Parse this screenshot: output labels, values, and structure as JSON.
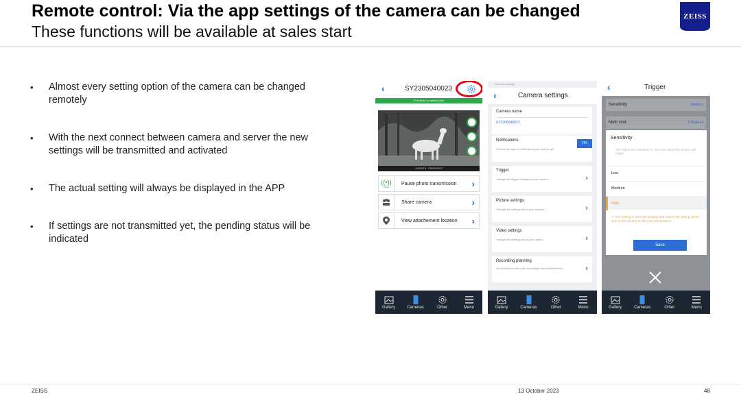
{
  "header": {
    "title": "Remote control: Via the app settings of the camera can be changed",
    "subtitle": "These functions will be available at sales start",
    "logo": "ZEISS"
  },
  "bullets": [
    "Almost every setting option of the camera can be changed remotely",
    "With the next connect between camera and server the new settings will be transmitted and activated",
    "The actual setting will always be displayed in the APP",
    "If settings are not transmitted yet, the pending status will be indicated"
  ],
  "phone1": {
    "camera_id": "SY2305040023",
    "sync_banner": "Pull down to synchronize",
    "photo_caption": "04/04/15 - 05/26/2023",
    "status_small": "Online",
    "rows": [
      "Pause photo transmission",
      "Share camera",
      "View attachement location"
    ]
  },
  "phone2": {
    "status_small": "Camera settings",
    "title": "Camera settings",
    "camera_name_label": "Camera name",
    "camera_name_value": "SY2305040023",
    "notifications": {
      "title": "Notifications",
      "desc": "Choose the type of notifications you want to get",
      "toggle": "ON"
    },
    "cards": [
      {
        "title": "Trigger",
        "desc": "Change the trigger settings of your camera"
      },
      {
        "title": "Picture settings",
        "desc": "Change the settings about your pictures"
      },
      {
        "title": "Video settings",
        "desc": "Change the settings about your videos"
      },
      {
        "title": "Recording planning",
        "desc": "All functions to plan your recordings and transmissions"
      }
    ]
  },
  "phone3": {
    "title": "Trigger",
    "rows": [
      {
        "key": "Sensitivity",
        "value": "Medium"
      },
      {
        "key": "Multi shot",
        "value": "5 Pictures"
      }
    ],
    "modal": {
      "title": "Sensitivity",
      "desc": "The higher the sensitivity is, the more likely the camera will trigger",
      "options": [
        "Low",
        "Medium",
        "High"
      ],
      "selected": "High",
      "warning": "This setting is currently pending due reason the setting will be sent to the camera on the next transmission",
      "save": "Save"
    }
  },
  "tabbar": [
    "Gallery",
    "Cameras",
    "Other",
    "Menu"
  ],
  "footer": {
    "brand": "ZEISS",
    "date": "13 October 2023",
    "page": "48"
  },
  "colors": {
    "accent_blue": "#2b6fd6",
    "green": "#2fa84f",
    "highlight_red": "#e30613",
    "zeiss_blue": "#141e8c"
  }
}
